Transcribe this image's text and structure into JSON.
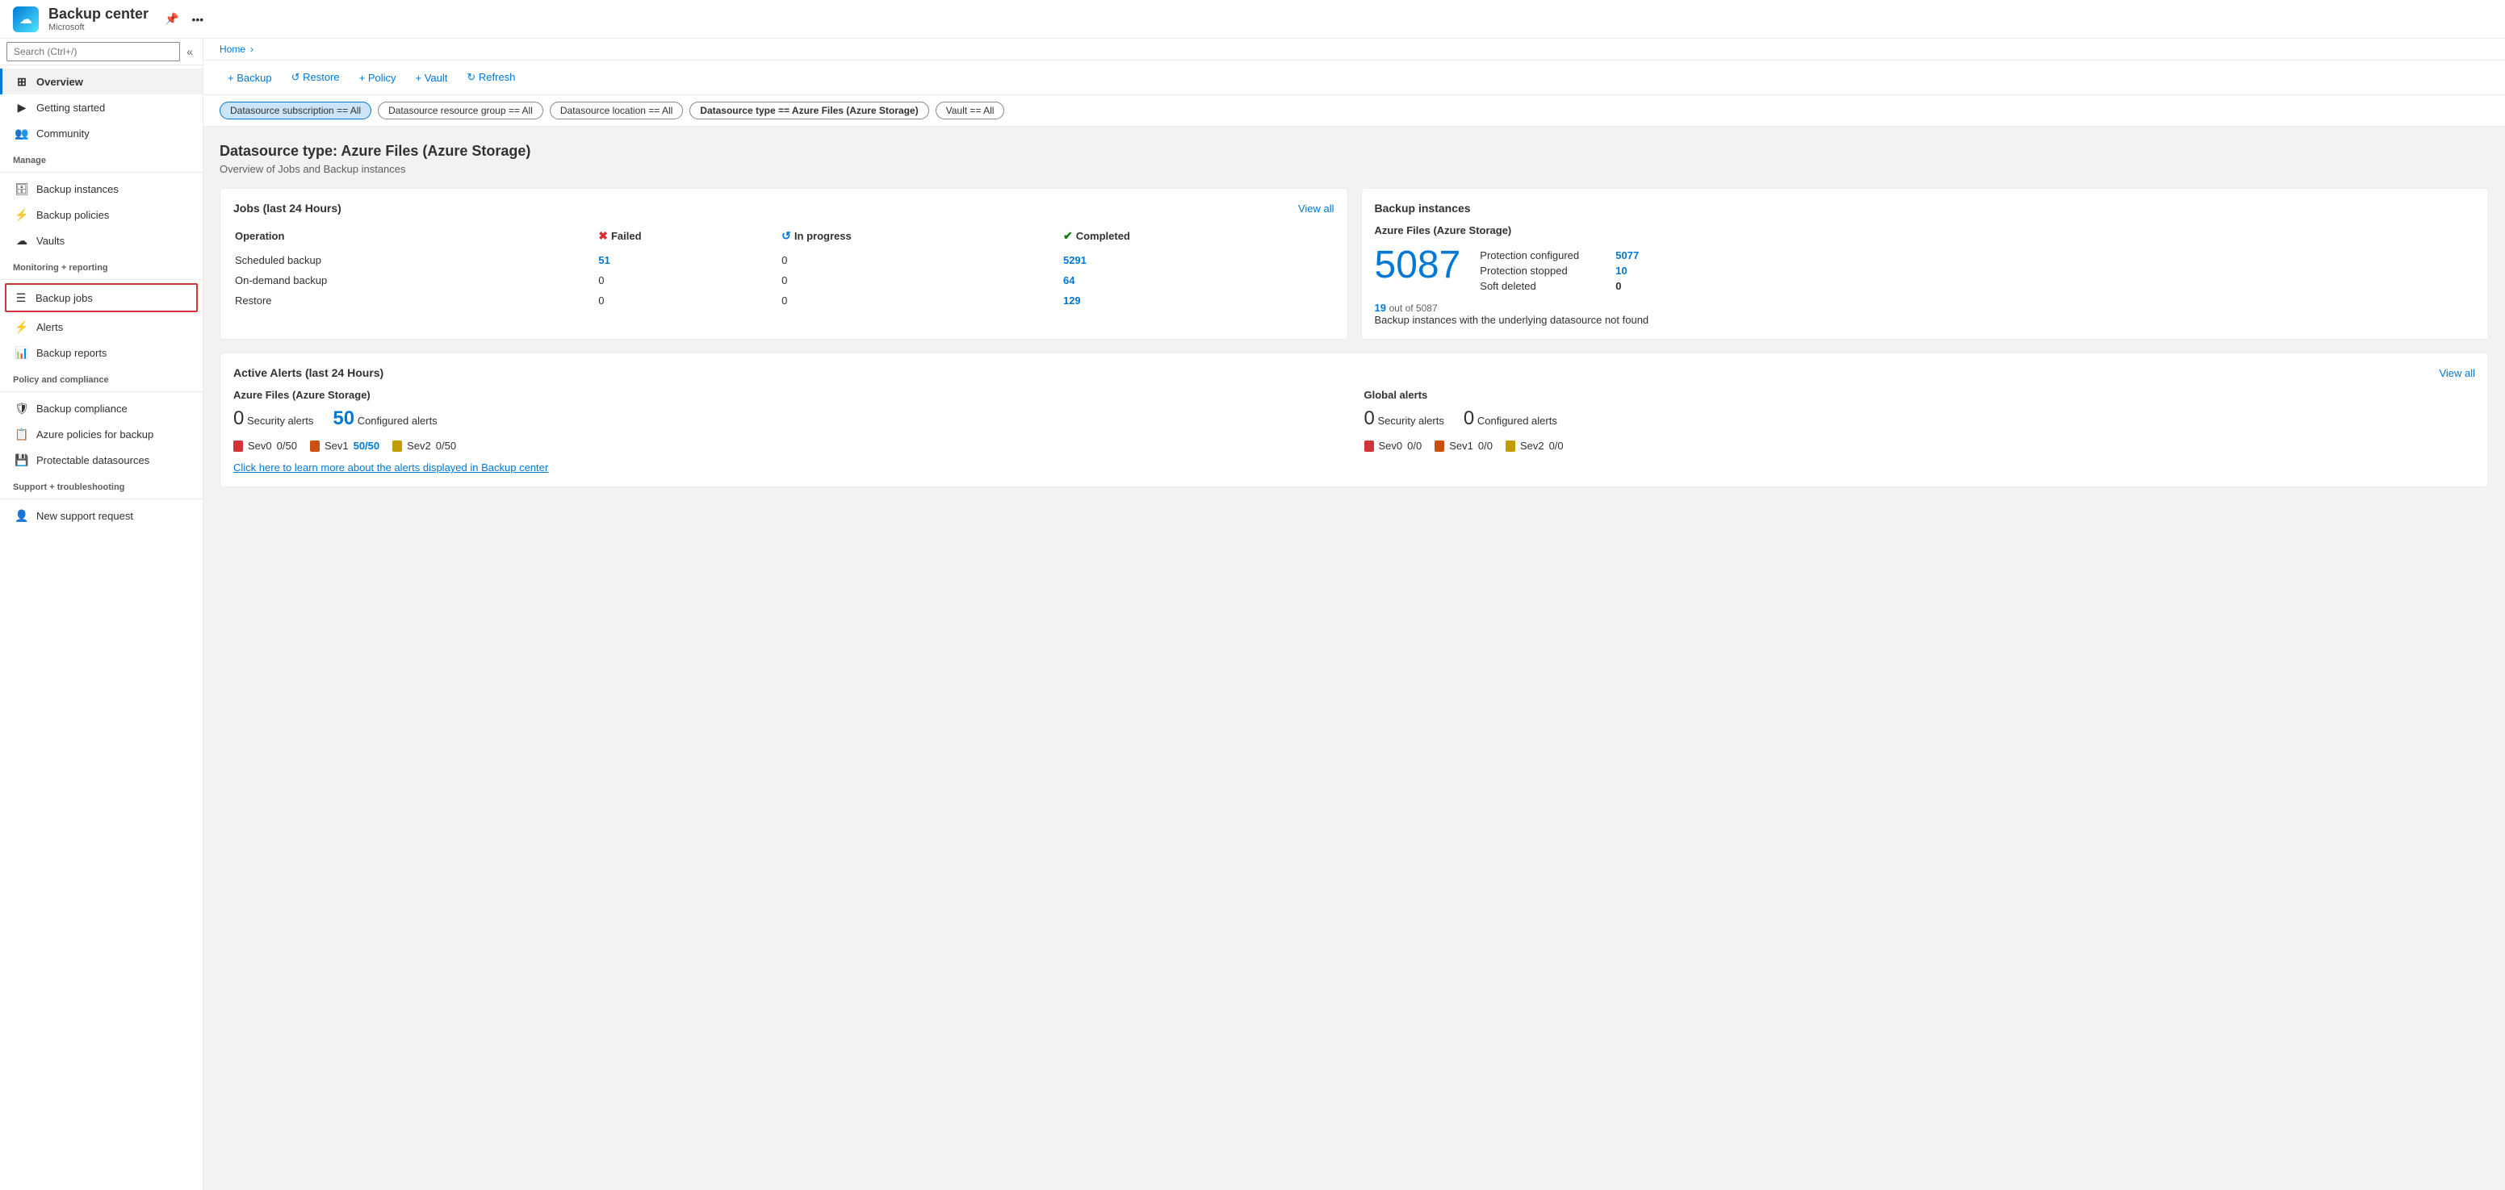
{
  "app": {
    "title": "Backup center",
    "subtitle": "Microsoft",
    "icon": "☁"
  },
  "breadcrumb": {
    "home": "Home",
    "separator": "›"
  },
  "toolbar": {
    "backup": "+ Backup",
    "restore": "↺ Restore",
    "policy": "+ Policy",
    "vault": "+ Vault",
    "refresh": "↻ Refresh"
  },
  "search": {
    "placeholder": "Search (Ctrl+/)"
  },
  "filters": [
    {
      "id": "datasource-subscription",
      "label": "Datasource subscription == All",
      "active": true
    },
    {
      "id": "datasource-resource-group",
      "label": "Datasource resource group == All",
      "active": false
    },
    {
      "id": "datasource-location",
      "label": "Datasource location == All",
      "active": false
    },
    {
      "id": "datasource-type",
      "label": "Datasource type == Azure Files (Azure Storage)",
      "active": false
    },
    {
      "id": "vault",
      "label": "Vault == All",
      "active": false
    }
  ],
  "page": {
    "title": "Datasource type: Azure Files (Azure Storage)",
    "subtitle": "Overview of Jobs and Backup instances"
  },
  "jobs_card": {
    "title": "Jobs (last 24 Hours)",
    "view_all": "View all",
    "headers": {
      "operation": "Operation",
      "failed": "Failed",
      "in_progress": "In progress",
      "completed": "Completed"
    },
    "rows": [
      {
        "operation": "Scheduled backup",
        "failed": "51",
        "failed_is_link": true,
        "in_progress": "0",
        "completed": "5291",
        "completed_is_link": true
      },
      {
        "operation": "On-demand backup",
        "failed": "0",
        "failed_is_link": false,
        "in_progress": "0",
        "completed": "64",
        "completed_is_link": true
      },
      {
        "operation": "Restore",
        "failed": "0",
        "failed_is_link": false,
        "in_progress": "0",
        "completed": "129",
        "completed_is_link": true
      }
    ]
  },
  "backup_instances_card": {
    "title": "Backup instances",
    "subtitle": "Azure Files (Azure Storage)",
    "total": "5087",
    "stats": [
      {
        "label": "Protection configured",
        "value": "5077",
        "is_link": true
      },
      {
        "label": "Protection stopped",
        "value": "10",
        "is_link": true
      },
      {
        "label": "Soft deleted",
        "value": "0",
        "is_bold": true
      }
    ],
    "footer_num": "19",
    "footer_of": "out of 5087",
    "footer_desc": "Backup instances with the underlying datasource not found"
  },
  "alerts_card": {
    "title": "Active Alerts (last 24 Hours)",
    "view_all": "View all",
    "azure_section": {
      "title": "Azure Files (Azure Storage)",
      "security_count": "0",
      "security_label": "Security alerts",
      "configured_count": "50",
      "configured_label": "Configured alerts",
      "severities": [
        {
          "level": "Sev0",
          "value": "0/50",
          "color": "red"
        },
        {
          "level": "Sev1",
          "value": "50/50",
          "value_colored": true,
          "color": "orange"
        },
        {
          "level": "Sev2",
          "value": "0/50",
          "color": "yellow"
        }
      ]
    },
    "global_section": {
      "title": "Global alerts",
      "security_count": "0",
      "security_label": "Security alerts",
      "configured_count": "0",
      "configured_label": "Configured alerts",
      "severities": [
        {
          "level": "Sev0",
          "value": "0/0",
          "color": "red"
        },
        {
          "level": "Sev1",
          "value": "0/0",
          "color": "orange"
        },
        {
          "level": "Sev2",
          "value": "0/0",
          "color": "yellow"
        }
      ]
    },
    "link_text": "Click here to learn more about the alerts displayed in Backup center"
  },
  "sidebar": {
    "nav_items": [
      {
        "id": "overview",
        "label": "Overview",
        "icon": "⊞",
        "section": null,
        "active": true
      },
      {
        "id": "getting-started",
        "label": "Getting started",
        "icon": "▶",
        "section": null
      },
      {
        "id": "community",
        "label": "Community",
        "icon": "👥",
        "section": null
      },
      {
        "id": "manage-label",
        "label": "Manage",
        "is_section": true
      },
      {
        "id": "backup-instances",
        "label": "Backup instances",
        "icon": "🗄",
        "section": "Manage"
      },
      {
        "id": "backup-policies",
        "label": "Backup policies",
        "icon": "⚡",
        "section": "Manage"
      },
      {
        "id": "vaults",
        "label": "Vaults",
        "icon": "☁",
        "section": "Manage"
      },
      {
        "id": "monitoring-label",
        "label": "Monitoring + reporting",
        "is_section": true
      },
      {
        "id": "backup-jobs",
        "label": "Backup jobs",
        "icon": "☰",
        "section": "Monitoring",
        "highlighted": true
      },
      {
        "id": "alerts",
        "label": "Alerts",
        "icon": "⚡",
        "section": "Monitoring"
      },
      {
        "id": "backup-reports",
        "label": "Backup reports",
        "icon": "📊",
        "section": "Monitoring"
      },
      {
        "id": "policy-label",
        "label": "Policy and compliance",
        "is_section": true
      },
      {
        "id": "backup-compliance",
        "label": "Backup compliance",
        "icon": "🛡",
        "section": "Policy"
      },
      {
        "id": "azure-policies",
        "label": "Azure policies for backup",
        "icon": "📋",
        "section": "Policy"
      },
      {
        "id": "protectable-datasources",
        "label": "Protectable datasources",
        "icon": "💾",
        "section": "Policy"
      },
      {
        "id": "support-label",
        "label": "Support + troubleshooting",
        "is_section": true
      },
      {
        "id": "new-support-request",
        "label": "New support request",
        "icon": "👤",
        "section": "Support"
      }
    ]
  }
}
